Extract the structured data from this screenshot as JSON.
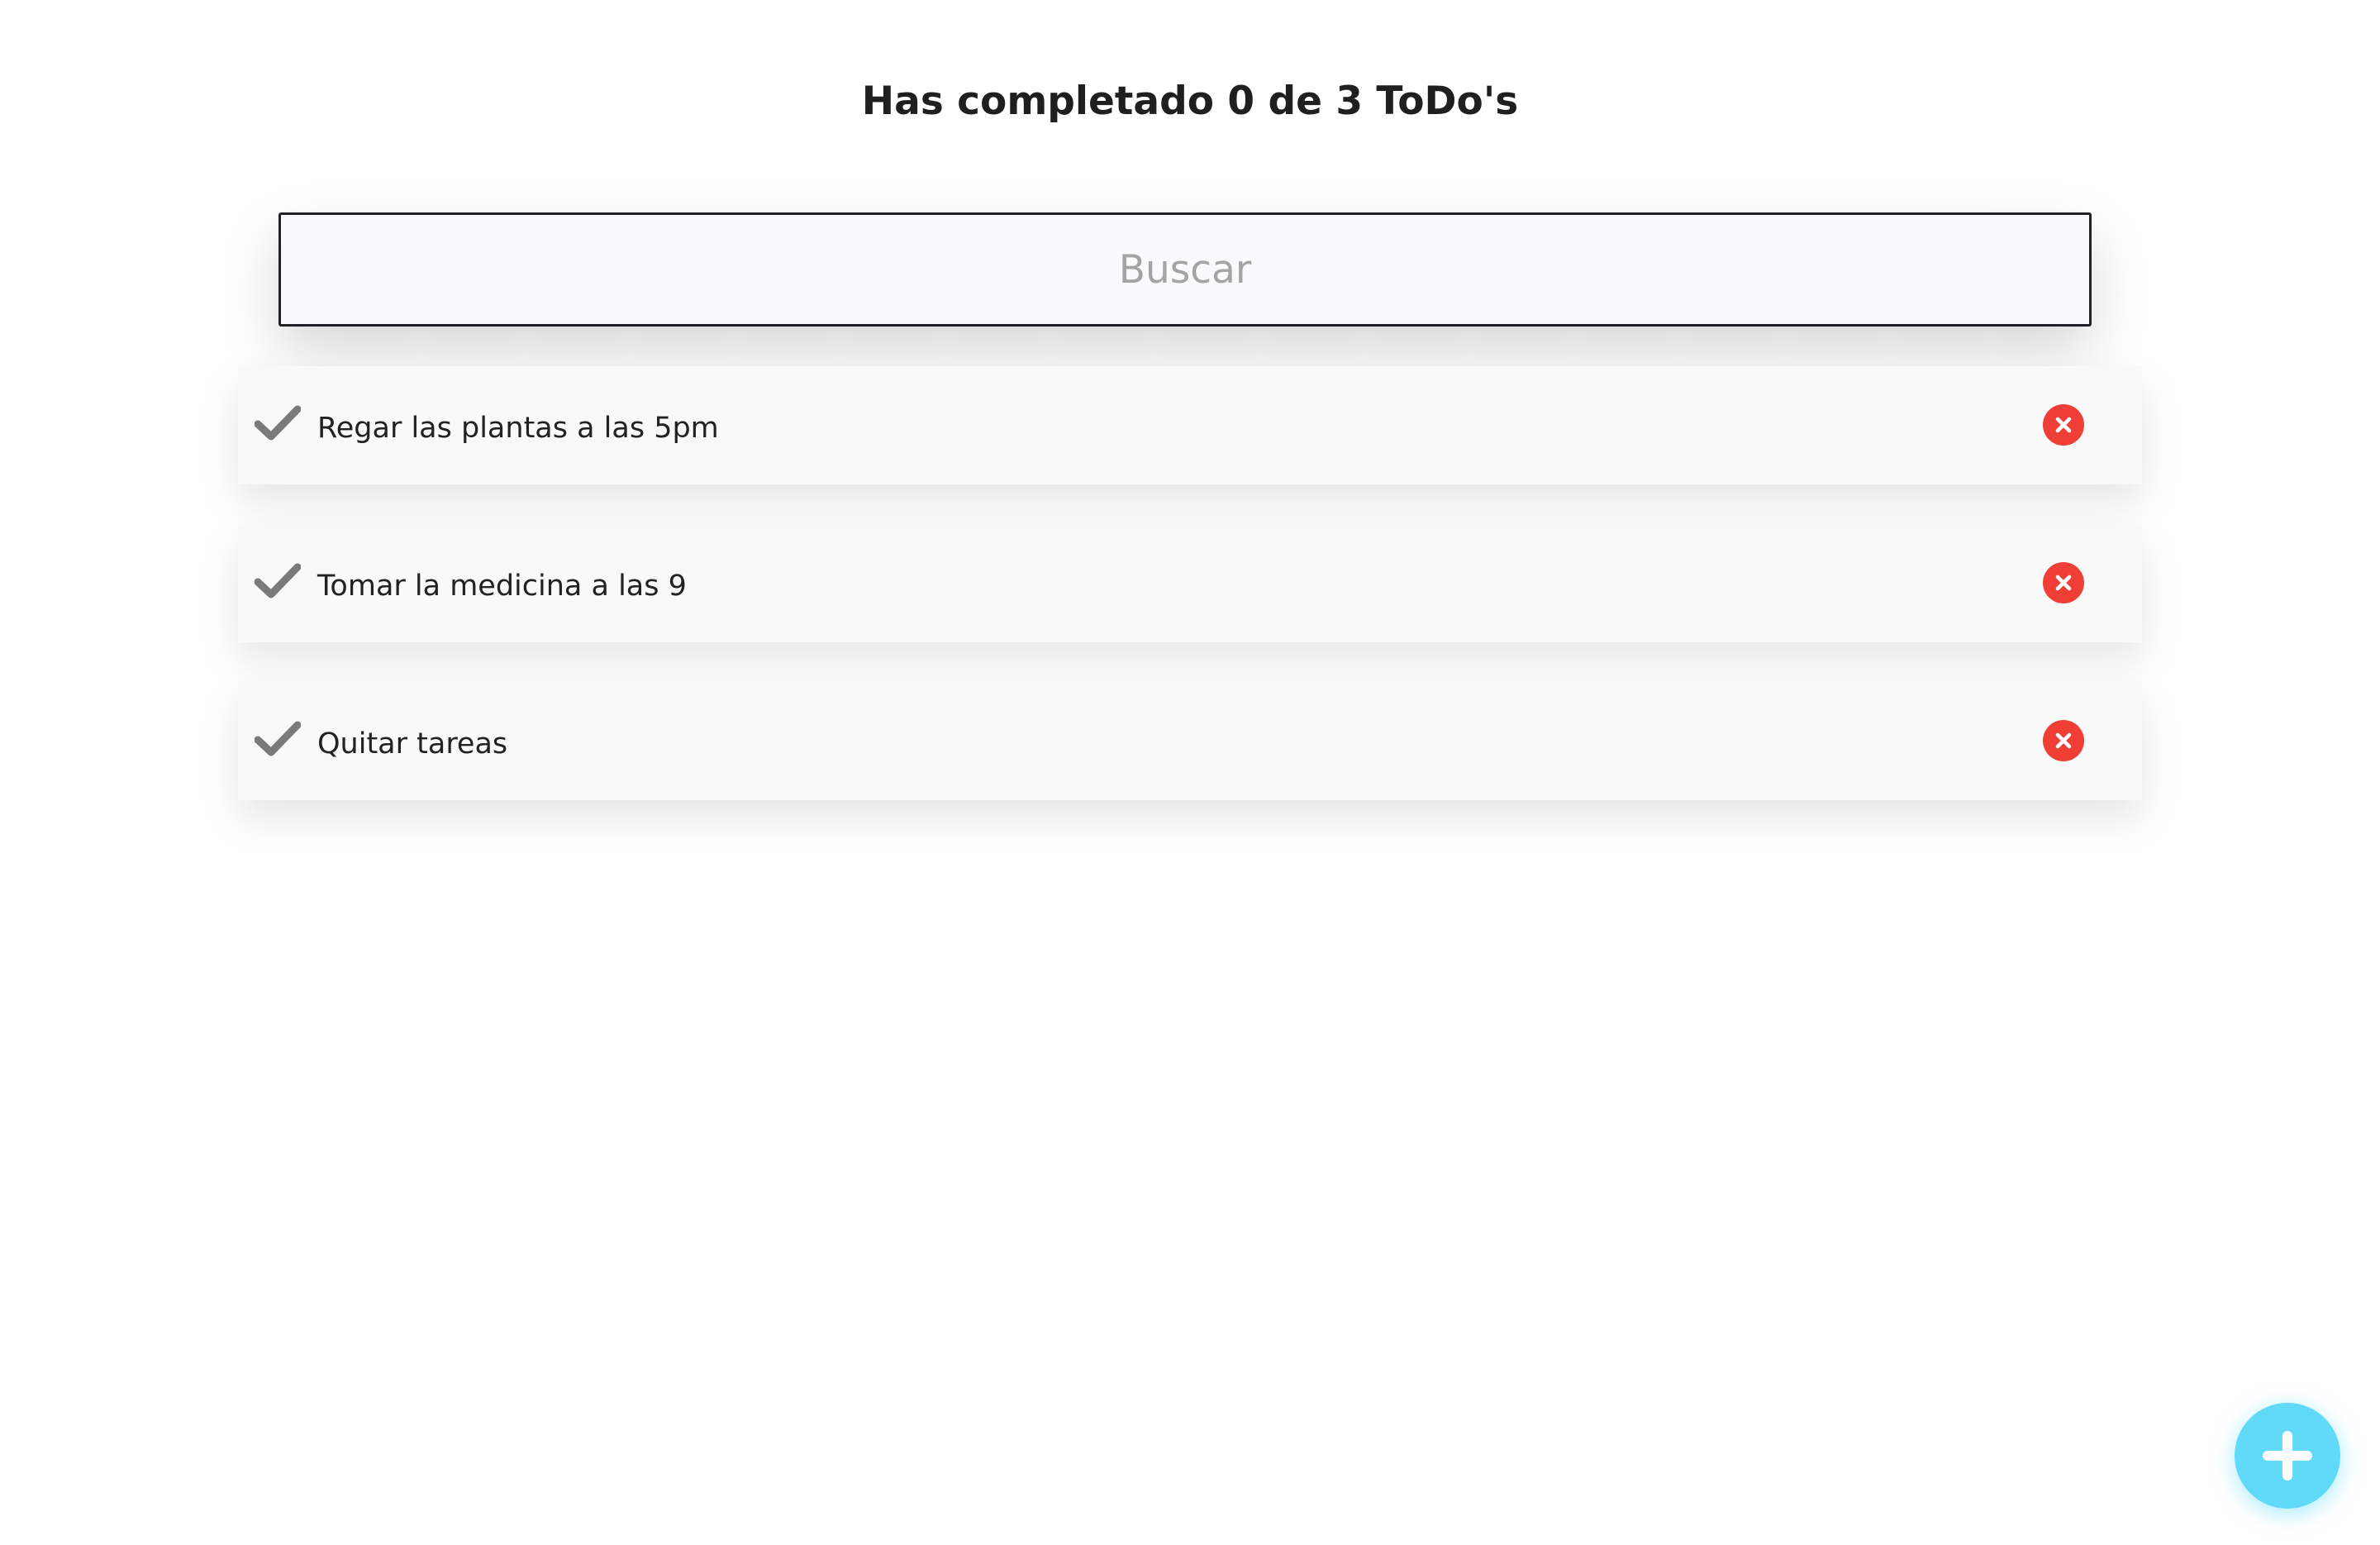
{
  "header": {
    "title": "Has completado 0 de 3 ToDo's"
  },
  "search": {
    "placeholder": "Buscar",
    "value": ""
  },
  "todos": [
    {
      "text": "Regar las plantas a las 5pm",
      "completed": false
    },
    {
      "text": "Tomar la medicina a las 9",
      "completed": false
    },
    {
      "text": "Quitar tareas",
      "completed": false
    }
  ],
  "icons": {
    "complete": "check-icon",
    "delete": "close-circle-icon",
    "add": "plus-icon"
  },
  "colors": {
    "check": "#7a7a7a",
    "delete": "#ef3e36",
    "add_button": "#61dafa",
    "title_text": "#1f1f1f",
    "placeholder": "#a4a4a4"
  }
}
